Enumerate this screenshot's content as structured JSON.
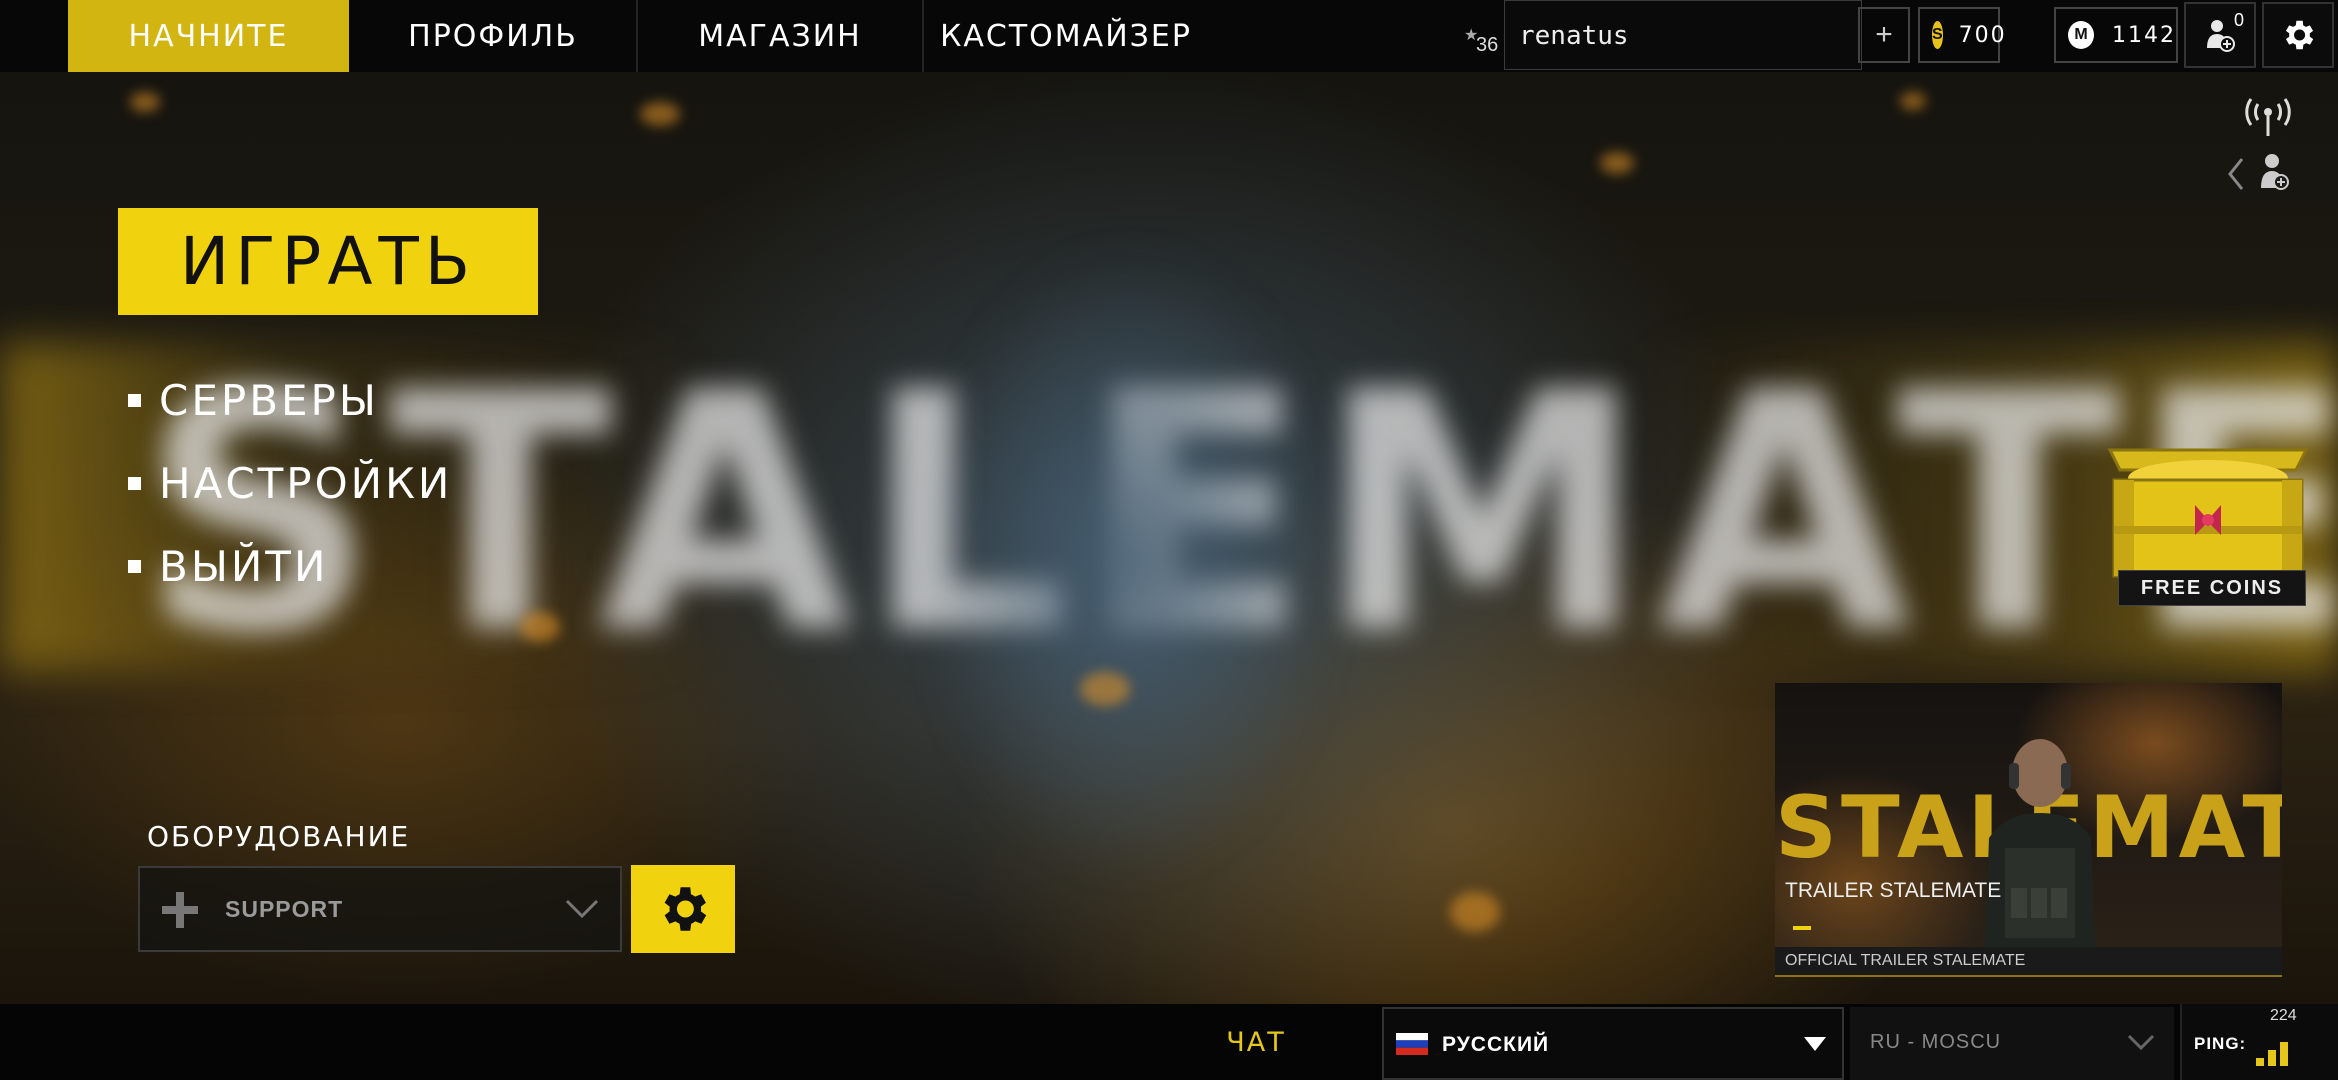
{
  "nav": {
    "tabs": [
      {
        "label": "НАЧНИТЕ",
        "active": true
      },
      {
        "label": "ПРОФИЛЬ",
        "active": false
      },
      {
        "label": "МАГАЗИН",
        "active": false
      },
      {
        "label": "КАСТОМАЙЗЕР",
        "active": false
      }
    ]
  },
  "player": {
    "level": "36",
    "username": "renatus",
    "add_label": "+",
    "coins": {
      "icon": "S",
      "value": "700"
    },
    "money": {
      "icon": "M",
      "value": "1142"
    },
    "friend_requests": "0"
  },
  "menu": {
    "play_label": "ИГРАТЬ",
    "items": [
      {
        "label": "СЕРВЕРЫ"
      },
      {
        "label": "НАСТРОЙКИ"
      },
      {
        "label": "ВЫЙТИ"
      }
    ]
  },
  "equipment": {
    "title": "ОБОРУДОВАНИЕ",
    "selected": "SUPPORT"
  },
  "promo": {
    "free_coins_label": "FREE COINS"
  },
  "trailer": {
    "logo_text": "STALEMATE",
    "title": "TRAILER STALEMATE",
    "caption": "OFFICIAL TRAILER STALEMATE"
  },
  "background": {
    "big_text": "STALEMATE"
  },
  "bottom": {
    "chat_label": "ЧАТ",
    "language": "РУССКИЙ",
    "server": "RU - MOSCU",
    "ping_label": "PING:",
    "ping_value": "224"
  },
  "colors": {
    "accent": "#f0d20f",
    "active_tab": "#d3b512",
    "chat": "#e5c61a"
  }
}
